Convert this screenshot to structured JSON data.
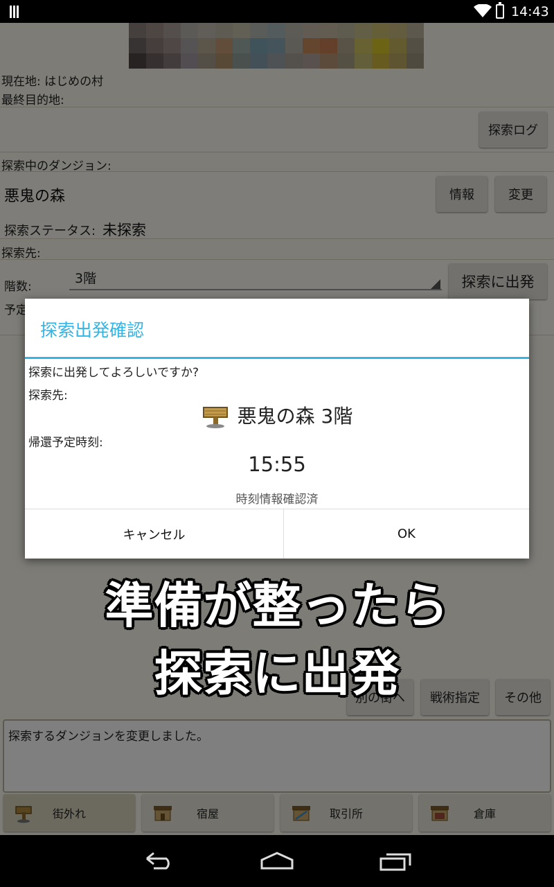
{
  "status_bar": {
    "time": "14:43"
  },
  "app": {
    "location_label": "現在地: はじめの村",
    "final_destination_label": "最終目的地:",
    "explore_log_button": "探索ログ",
    "exploring_dungeon_label": "探索中のダンジョン:",
    "dungeon_name": "悪鬼の森",
    "info_button": "情報",
    "change_button": "変更",
    "explore_status_label": "探索ステータス:",
    "explore_status_value": "未探索",
    "destination_label": "探索先:",
    "floor_label": "階数:",
    "floor_value": "3階",
    "depart_button": "探索に出発",
    "schedule_label_partial": "予定",
    "other_town_button": "別の街へ",
    "tactics_button": "戦術指定",
    "other_button": "その他",
    "log_text": "探索するダンジョンを変更しました。",
    "tabs": [
      {
        "label": "街外れ",
        "icon": "signpost-icon"
      },
      {
        "label": "宿屋",
        "icon": "inn-icon"
      },
      {
        "label": "取引所",
        "icon": "exchange-icon"
      },
      {
        "label": "倉庫",
        "icon": "warehouse-icon"
      }
    ]
  },
  "dialog": {
    "title": "探索出発確認",
    "question": "探索に出発してよろしいですか?",
    "destination_label": "探索先:",
    "destination_value": "悪鬼の森 3階",
    "return_time_label": "帰還予定時刻:",
    "return_time_value": "15:55",
    "confirmed_note": "時刻情報確認済",
    "cancel_button": "キャンセル",
    "ok_button": "OK",
    "accent_color": "#33b5e5"
  },
  "caption": {
    "line1": "準備が整ったら",
    "line2": "探索に出発"
  }
}
